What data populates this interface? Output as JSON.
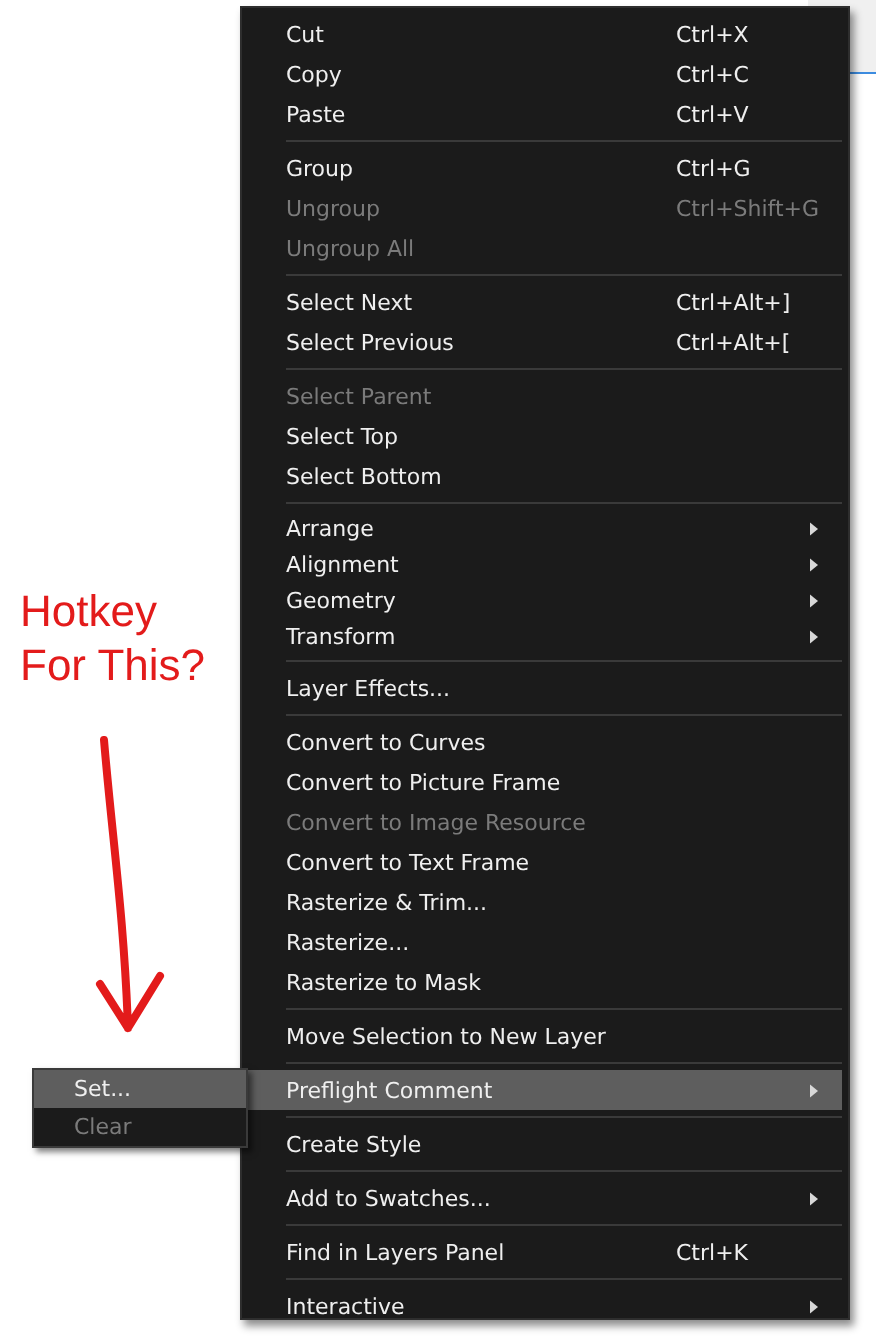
{
  "annotation": {
    "text": "Hotkey For This?"
  },
  "menu": {
    "sections": [
      {
        "items": [
          {
            "label": "Cut",
            "shortcut": "Ctrl+X",
            "disabled": false,
            "submenu": false,
            "selected": false
          },
          {
            "label": "Copy",
            "shortcut": "Ctrl+C",
            "disabled": false,
            "submenu": false,
            "selected": false
          },
          {
            "label": "Paste",
            "shortcut": "Ctrl+V",
            "disabled": false,
            "submenu": false,
            "selected": false
          }
        ]
      },
      {
        "items": [
          {
            "label": "Group",
            "shortcut": "Ctrl+G",
            "disabled": false,
            "submenu": false,
            "selected": false
          },
          {
            "label": "Ungroup",
            "shortcut": "Ctrl+Shift+G",
            "disabled": true,
            "submenu": false,
            "selected": false
          },
          {
            "label": "Ungroup All",
            "disabled": true,
            "submenu": false,
            "selected": false
          }
        ]
      },
      {
        "items": [
          {
            "label": "Select Next",
            "shortcut": "Ctrl+Alt+]",
            "disabled": false,
            "submenu": false,
            "selected": false
          },
          {
            "label": "Select Previous",
            "shortcut": "Ctrl+Alt+[",
            "disabled": false,
            "submenu": false,
            "selected": false
          }
        ]
      },
      {
        "items": [
          {
            "label": "Select Parent",
            "disabled": true,
            "submenu": false,
            "selected": false
          },
          {
            "label": "Select Top",
            "disabled": false,
            "submenu": false,
            "selected": false
          },
          {
            "label": "Select Bottom",
            "disabled": false,
            "submenu": false,
            "selected": false
          }
        ]
      },
      {
        "items": [
          {
            "label": "Arrange",
            "disabled": false,
            "submenu": true,
            "selected": false
          },
          {
            "label": "Alignment",
            "disabled": false,
            "submenu": true,
            "selected": false
          },
          {
            "label": "Geometry",
            "disabled": false,
            "submenu": true,
            "selected": false
          },
          {
            "label": "Transform",
            "disabled": false,
            "submenu": true,
            "selected": false
          }
        ]
      },
      {
        "items": [
          {
            "label": "Layer Effects...",
            "disabled": false,
            "submenu": false,
            "selected": false
          }
        ]
      },
      {
        "items": [
          {
            "label": "Convert to Curves",
            "disabled": false,
            "submenu": false,
            "selected": false
          },
          {
            "label": "Convert to Picture Frame",
            "disabled": false,
            "submenu": false,
            "selected": false
          },
          {
            "label": "Convert to Image Resource",
            "disabled": true,
            "submenu": false,
            "selected": false
          },
          {
            "label": "Convert to Text Frame",
            "disabled": false,
            "submenu": false,
            "selected": false
          },
          {
            "label": "Rasterize & Trim...",
            "disabled": false,
            "submenu": false,
            "selected": false
          },
          {
            "label": "Rasterize...",
            "disabled": false,
            "submenu": false,
            "selected": false
          },
          {
            "label": "Rasterize to Mask",
            "disabled": false,
            "submenu": false,
            "selected": false
          }
        ]
      },
      {
        "items": [
          {
            "label": "Move Selection to New Layer",
            "disabled": false,
            "submenu": false,
            "selected": false
          }
        ]
      },
      {
        "items": [
          {
            "label": "Preflight Comment",
            "disabled": false,
            "submenu": true,
            "selected": true
          }
        ]
      },
      {
        "items": [
          {
            "label": "Create Style",
            "disabled": false,
            "submenu": false,
            "selected": false
          }
        ]
      },
      {
        "items": [
          {
            "label": "Add to Swatches...",
            "disabled": false,
            "submenu": true,
            "selected": false
          }
        ]
      },
      {
        "items": [
          {
            "label": "Find in Layers Panel",
            "shortcut": "Ctrl+K",
            "disabled": false,
            "submenu": false,
            "selected": false
          }
        ]
      },
      {
        "items": [
          {
            "label": "Interactive",
            "disabled": false,
            "submenu": true,
            "selected": false
          }
        ]
      }
    ]
  },
  "submenu": {
    "items": [
      {
        "label": "Set...",
        "disabled": false,
        "selected": true
      },
      {
        "label": "Clear",
        "disabled": true,
        "selected": false
      }
    ]
  }
}
